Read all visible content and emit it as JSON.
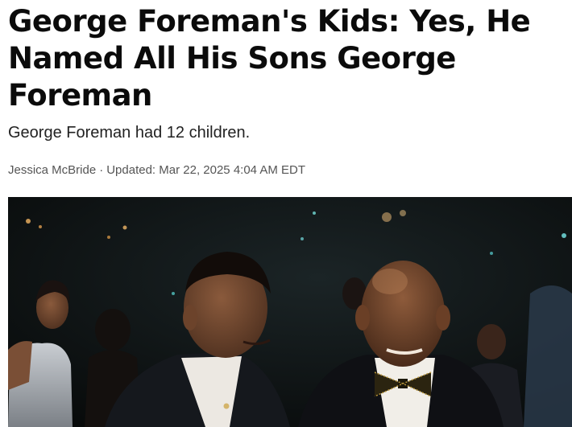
{
  "article": {
    "headline": "George Foreman's Kids: Yes, He Named All His Sons George Foreman",
    "subheadline": "George Foreman had 12 children.",
    "author": "Jessica McBride",
    "separator": "·",
    "updated_label": "Updated:",
    "updated_time": "Mar 22, 2025 4:04 AM EDT"
  }
}
